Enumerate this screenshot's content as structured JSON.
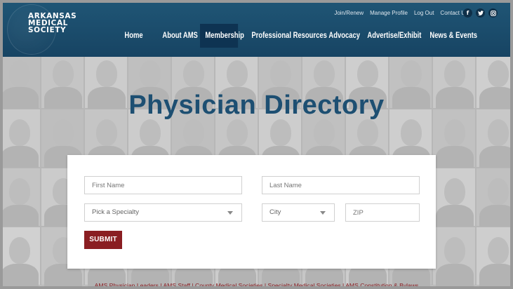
{
  "brand": {
    "logo_lines": [
      "ARKANSAS",
      "MEDICAL",
      "SOCIETY"
    ]
  },
  "utility_nav": [
    "Join/Renew",
    "Manage Profile",
    "Log Out",
    "Contact Us"
  ],
  "social": [
    {
      "icon": "facebook-icon",
      "glyph": "f"
    },
    {
      "icon": "twitter-icon",
      "glyph": "t"
    },
    {
      "icon": "instagram-icon",
      "glyph": "◙"
    }
  ],
  "main_nav": [
    {
      "label": "Home",
      "active": false
    },
    {
      "label": "About AMS",
      "active": false
    },
    {
      "label": "Membership",
      "active": true
    },
    {
      "label": "Professional Resources",
      "active": false
    },
    {
      "label": "Advocacy",
      "active": false
    },
    {
      "label": "Advertise/Exhibit",
      "active": false
    },
    {
      "label": "News & Events",
      "active": false
    }
  ],
  "page": {
    "title": "Physician Directory"
  },
  "search": {
    "first_name_placeholder": "First Name",
    "last_name_placeholder": "Last Name",
    "specialty_value": "Pick a Specialty",
    "city_value": "City",
    "zip_placeholder": "ZIP",
    "submit_label": "SUBMIT"
  },
  "footer_links": [
    "AMS Physician Leaders",
    "AMS Staff",
    "County Medical Societies",
    "Specialty Medical Societies",
    "AMS Constitution & Bylaws"
  ],
  "colors": {
    "header": "#1f5575",
    "active_nav": "#0e3352",
    "title": "#1d4f72",
    "submit": "#8a1e22"
  }
}
